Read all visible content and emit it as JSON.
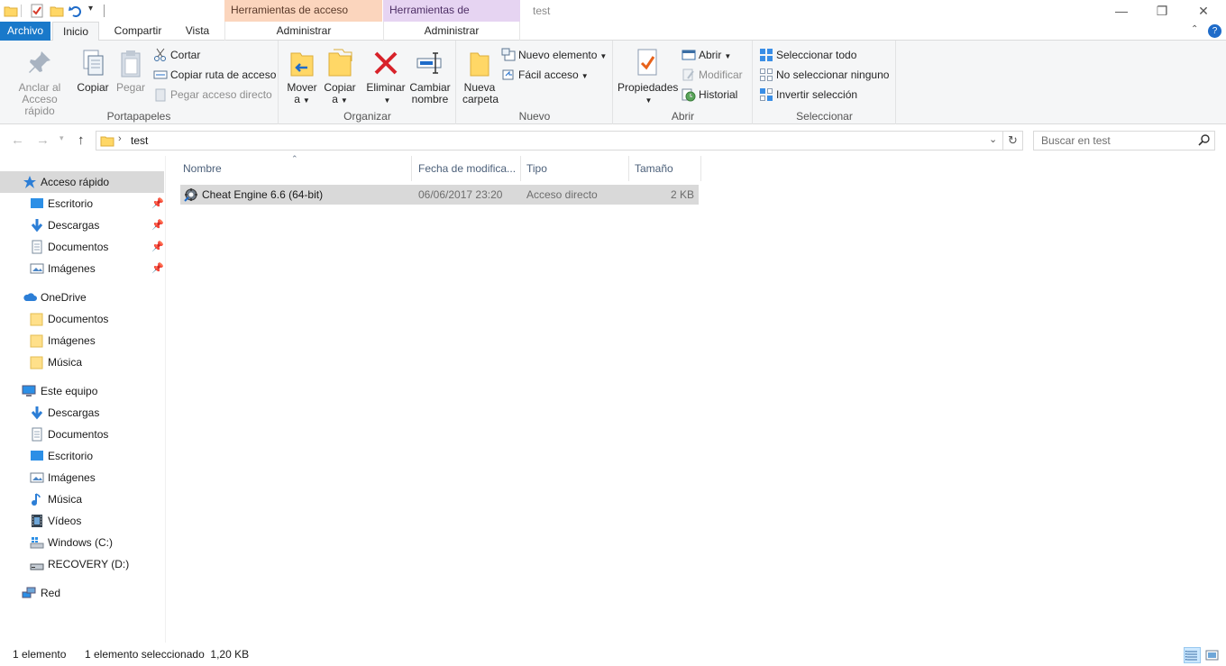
{
  "window": {
    "title": "test",
    "context_tab_shortcut": "Herramientas de acceso directo",
    "context_tab_app": "Herramientas de aplicación",
    "context_sub_shortcut": "Administrar",
    "context_sub_app": "Administrar",
    "minimize": "—",
    "maximize": "❐",
    "close": "✕"
  },
  "tabs": {
    "file": "Archivo",
    "home": "Inicio",
    "share": "Compartir",
    "view": "Vista",
    "help": "?"
  },
  "ribbon": {
    "portapapeles": {
      "label": "Portapapeles",
      "pin_l1": "Anclar al",
      "pin_l2": "Acceso rápido",
      "copy": "Copiar",
      "paste": "Pegar",
      "cut": "Cortar",
      "copy_path": "Copiar ruta de acceso",
      "paste_shortcut": "Pegar acceso directo"
    },
    "organizar": {
      "label": "Organizar",
      "move_l1": "Mover",
      "move_l2": "a",
      "copy_l1": "Copiar",
      "copy_l2": "a",
      "delete": "Eliminar",
      "rename_l1": "Cambiar",
      "rename_l2": "nombre"
    },
    "nuevo": {
      "label": "Nuevo",
      "folder_l1": "Nueva",
      "folder_l2": "carpeta",
      "new_item": "Nuevo elemento",
      "easy_access": "Fácil acceso"
    },
    "abrir": {
      "label": "Abrir",
      "properties": "Propiedades",
      "open": "Abrir",
      "edit": "Modificar",
      "history": "Historial"
    },
    "seleccionar": {
      "label": "Seleccionar",
      "select_all": "Seleccionar todo",
      "select_none": "No seleccionar ninguno",
      "invert": "Invertir selección"
    }
  },
  "address": {
    "path": "test",
    "search_placeholder": "Buscar en test"
  },
  "sidebar": {
    "quick_access": "Acceso rápido",
    "quick_items": [
      "Escritorio",
      "Descargas",
      "Documentos",
      "Imágenes"
    ],
    "onedrive": "OneDrive",
    "onedrive_items": [
      "Documentos",
      "Imágenes",
      "Música"
    ],
    "this_pc": "Este equipo",
    "pc_items": [
      "Descargas",
      "Documentos",
      "Escritorio",
      "Imágenes",
      "Música",
      "Vídeos",
      "Windows (C:)",
      "RECOVERY (D:)"
    ],
    "network": "Red"
  },
  "filelist": {
    "columns": {
      "name": "Nombre",
      "date": "Fecha de modifica...",
      "type": "Tipo",
      "size": "Tamaño"
    },
    "rows": [
      {
        "name": "Cheat Engine 6.6 (64-bit)",
        "date": "06/06/2017 23:20",
        "type": "Acceso directo",
        "size": "2 KB"
      }
    ]
  },
  "status": {
    "count": "1 elemento",
    "selected": "1 elemento seleccionado  1,20 KB"
  }
}
